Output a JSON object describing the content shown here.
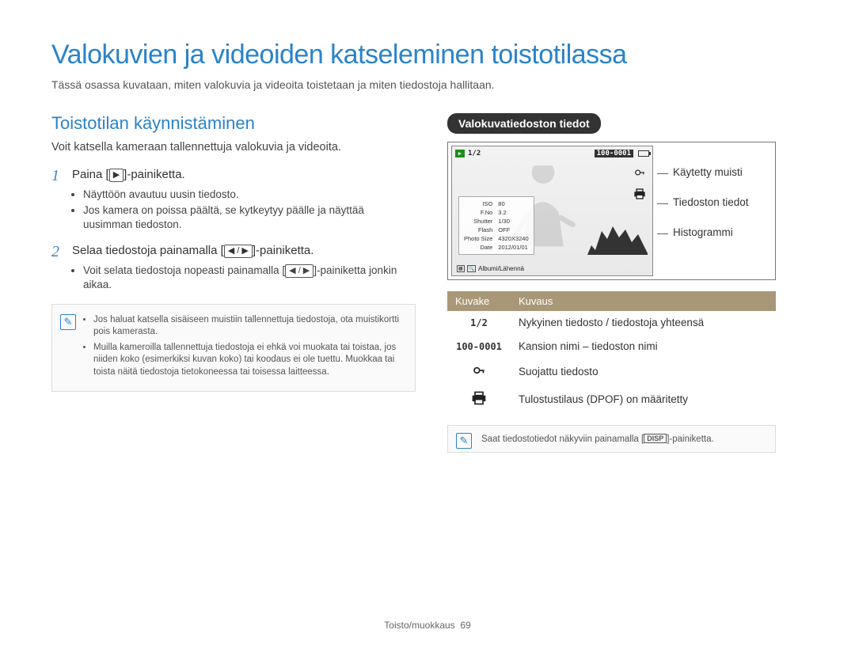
{
  "title": "Valokuvien ja videoiden katseleminen toistotilassa",
  "intro": "Tässä osassa kuvataan, miten valokuvia ja videoita toistetaan ja miten tiedostoja hallitaan.",
  "left": {
    "heading": "Toistotilan käynnistäminen",
    "lead": "Voit katsella kameraan tallennettuja valokuvia ja videoita.",
    "step1_pre": "Paina [",
    "step1_key": "▶",
    "step1_post": "]-painiketta.",
    "step1_bullets": [
      "Näyttöön avautuu uusin tiedosto.",
      "Jos kamera on poissa päältä, se kytkeytyy päälle ja näyttää uusimman tiedoston."
    ],
    "step2_pre": "Selaa tiedostoja painamalla [",
    "step2_key": "◀ / ▶",
    "step2_post": "]-painiketta.",
    "step2_bullets_pre": "Voit selata tiedostoja nopeasti painamalla [",
    "step2_bullets_key": "◀ / ▶",
    "step2_bullets_post": "]-painiketta jonkin aikaa.",
    "notes": [
      "Jos haluat katsella sisäiseen muistiin tallennettuja tiedostoja, ota muistikortti pois kamerasta.",
      "Muilla kameroilla tallennettuja tiedostoja ei ehkä voi muokata tai toistaa, jos niiden koko (esimerkiksi kuvan koko) tai koodaus ei ole tuettu. Muokkaa tai toista näitä tiedostoja tietokoneessa tai toisessa laitteessa."
    ]
  },
  "right": {
    "badge": "Valokuvatiedoston tiedot",
    "screen": {
      "counter": "1/2",
      "file": "100-0001",
      "info": [
        [
          "ISO",
          "80"
        ],
        [
          "F.No",
          "3.2"
        ],
        [
          "Shutter",
          "1/30"
        ],
        [
          "Flash",
          "OFF"
        ],
        [
          "Photo Size",
          "4320X3240"
        ],
        [
          "Date",
          "2012/01/01"
        ]
      ],
      "footer": "Albumi/Lähennä"
    },
    "callouts": [
      "Käytetty muisti",
      "Tiedoston tiedot",
      "Histogrammi"
    ],
    "table": {
      "head": [
        "Kuvake",
        "Kuvaus"
      ],
      "rows": [
        {
          "icon": "1/2",
          "text": "Nykyinen tiedosto / tiedostoja yhteensä"
        },
        {
          "icon": "100-0001",
          "text": "Kansion nimi – tiedoston nimi"
        },
        {
          "icon": "key",
          "text": "Suojattu tiedosto"
        },
        {
          "icon": "printer",
          "text": "Tulostustilaus (DPOF) on määritetty"
        }
      ]
    },
    "note_pre": "Saat tiedostotiedot näkyviin painamalla [",
    "note_key": "DISP",
    "note_post": "]-painiketta."
  },
  "footer_section": "Toisto/muokkaus",
  "footer_page": "69"
}
